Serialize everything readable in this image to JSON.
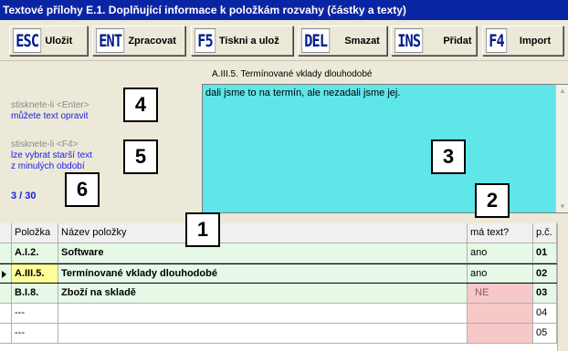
{
  "window": {
    "title": "Textové přílohy E.1.  Doplňující informace k položkám rozvahy (částky a texty)"
  },
  "toolbar": {
    "buttons": [
      {
        "key": "ESC",
        "label": "Uložit"
      },
      {
        "key": "ENT",
        "label": "Zpracovat"
      },
      {
        "key": "F5",
        "label": "Tiskni a ulož"
      },
      {
        "key": "DEL",
        "label": "Smazat"
      },
      {
        "key": "INS",
        "label": "Přidat"
      },
      {
        "key": "F4",
        "label": "Import"
      }
    ]
  },
  "editor": {
    "caption": "A.III.5.  Termínované vklady dlouhodobé",
    "text": "dali jsme to na termín, ale nezadali jsme jej."
  },
  "hints": {
    "enter_gray": "stisknete-li <Enter>",
    "enter_blue": "můžete text opravit",
    "f4_gray": "stisknete-li <F4>",
    "f4_blue_1": "lze vybrat starší text",
    "f4_blue_2": "z minulých období"
  },
  "counter": "3  /  30",
  "callouts": [
    "1",
    "2",
    "3",
    "4",
    "5",
    "6"
  ],
  "grid": {
    "headers": {
      "code": "Položka",
      "name": "Název položky",
      "has_text": "má text?",
      "pc": "p.č."
    },
    "rows": [
      {
        "code": "A.I.2.",
        "name": "Software",
        "has_text": "ano",
        "pc": "01"
      },
      {
        "code": "A.III.5.",
        "name": "Termínované vklady dlouhodobé",
        "has_text": "ano",
        "pc": "02"
      },
      {
        "code": "B.I.8.",
        "name": "Zboží na skladě",
        "has_text": "NE",
        "pc": "03"
      },
      {
        "code": "---",
        "name": "",
        "has_text": "",
        "pc": "04"
      },
      {
        "code": "---",
        "name": "",
        "has_text": "",
        "pc": "05"
      }
    ]
  },
  "colors": {
    "title_bar": "#0a25a4",
    "editor_bg": "#5fe6e9",
    "row_green": "#e6f9e6",
    "no_text": "#f7c8c8",
    "selected_code": "#ffff99",
    "hint_blue": "#1a1ae0"
  }
}
